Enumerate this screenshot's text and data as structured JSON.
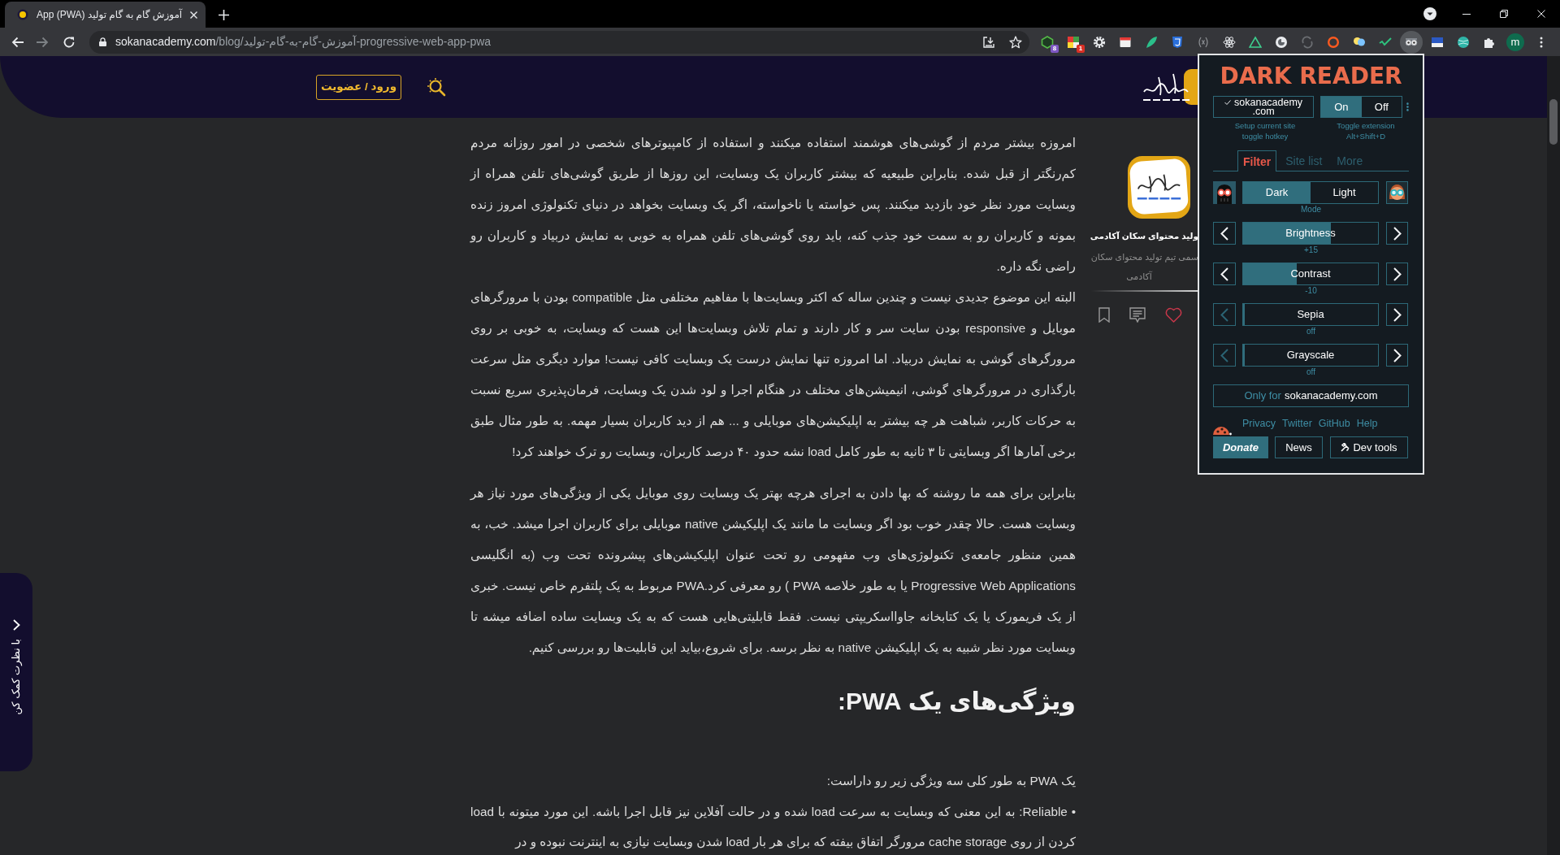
{
  "browser": {
    "tabs": [
      {
        "title": "آموزش گام به گام تولید App (PWA)",
        "selected": true
      }
    ],
    "address": {
      "host": "sokanacademy.com",
      "path": "/blog/آموزش-گام-به-گام-تولید-progressive-web-app-pwa"
    },
    "extensions": [
      {
        "kind": "puzzle",
        "active": false
      },
      {
        "kind": "globe",
        "active": false
      },
      {
        "kind": "banner",
        "active": false
      },
      {
        "kind": "goggles",
        "active": true
      },
      {
        "kind": "check",
        "active": false
      },
      {
        "kind": "bulb",
        "active": false
      },
      {
        "kind": "ring",
        "active": false
      },
      {
        "kind": "cycle",
        "active": false
      },
      {
        "kind": "disc",
        "active": false
      },
      {
        "kind": "triangle",
        "active": false
      },
      {
        "kind": "atom",
        "active": false
      },
      {
        "kind": "brackets",
        "active": false
      },
      {
        "kind": "shield",
        "active": false
      },
      {
        "kind": "leaf",
        "active": false
      },
      {
        "kind": "window",
        "active": false
      },
      {
        "kind": "gear",
        "active": false
      },
      {
        "kind": "grid",
        "active": false,
        "badge": {
          "text": "1",
          "color": "#d93025"
        }
      },
      {
        "kind": "hexagon",
        "active": false,
        "badge": {
          "text": "8",
          "color": "#7e57c2"
        }
      }
    ],
    "profile": {
      "initial": "m"
    }
  },
  "site_header": {
    "login_button": "ورود / عضویت"
  },
  "article": {
    "paragraphs": [
      "امروزه بیشتر مردم از گوشی‌های هوشمند استفاده میکنند و استفاده از کامپیوترهای شخصی در امور روزانه مردم کم‌رنگتر از قبل شده. بنابراین طبیعیه که بیشتر کاربران یک وبسایت، این روزها از طریق گوشی‌های تلفن همراه از وبسایت مورد نظر خود بازدید میکنند. پس خواسته یا ناخواسته، اگر یک وبسایت بخواهد در دنیای تکنولوژی امروز زنده بمونه و کاربران رو به سمت خود جذب کنه، باید روی گوشی‌های تلفن همراه به خوبی به نمایش دربیاد و کاربران رو راضی نگه داره.",
      "البته این موضوع جدیدی نیست و چندین ساله که اکثر وبسایت‌ها با مفاهیم مختلفی مثل compatible بودن با مرورگرهای موبایل و responsive بودن سایت سر و کار دارند و تمام تلاش وبسایت‌ها این هست که وبسایت، به خوبی بر روی مرورگرهای گوشی به نمایش دربیاد. اما امروزه تنها نمایش درست یک وبسایت کافی نیست! موارد دیگری مثل سرعت بارگذاری در مرورگرهای گوشی، انیمیشن‌های مختلف در هنگام اجرا و لود شدن یک وبسایت، فرمان‌پذیری سریع نسبت به حرکات کاربر، شباهت هر چه بیشتر به اپلیکیشن‌های موبایلی و ... هم از دید کاربران بسیار مهمه. به طور مثال طبق برخی آمارها اگر وبسایتی تا ۳ ثانیه به طور کامل load نشه حدود ۴۰ درصد کاربران، وبسایت رو ترک خواهند کرد!",
      "بنابراین برای همه ما روشنه که بها دادن به اجرای هرچه بهتر یک وبسایت روی موبایل یکی از ویژگی‌های مورد نیاز هر وبسایت هست. حالا چقدر خوب بود اگر وبسایت ما مانند یک اپلیکیشن native موبایلی برای کاربران اجرا میشد. خب، به همین منظور جامعه‌ی تکنولوژی‌های وب مفهومی رو تحت عنوان اپلیکیشن‌های پیشرونده تحت وب (به انگلیسی Progressive Web Applications یا به طور خلاصه PWA ) رو معرفی کرد.PWA مربوط به یک پلتفرم خاص نیست. خبری از یک فریمورک یا یک کتابخانه جاوااسکریپتی نیست. فقط قابلیتی‌هایی هست که به یک وبسایت ساده اضافه میشه تا وبسایت مورد نظر شبیه به یک اپلیکیشن native به نظر برسه. برای شروع،بیاید این قابلیت‌ها رو بررسی کنیم."
    ],
    "heading": "ویژگی‌های یک PWA:",
    "intro": "یک PWA به طور کلی سه ویژگی زیر رو داراست:",
    "bullets": [
      "• Reliable: به این معنی که وبسایت به سرعت load شده و در حالت آفلاین نیز قابل اجرا باشه. این مورد میتونه با load کردن از روی cache storage مرورگر اتفاق بیفته که برای هر بار load شدن وبسایت نیازی به اینترنت نبوده و در"
    ]
  },
  "author": {
    "name": "ولید محتوای سکان آکادمی",
    "bio": "سمی تیم تولید محتوای سکان آکادمی"
  },
  "feedback_tab": {
    "label": "با نظرت کمک کن"
  },
  "dark_reader": {
    "title": "DARK READER",
    "site_toggle": {
      "lines": [
        "sokanacademy",
        ".com"
      ],
      "checked": true
    },
    "power": [
      {
        "label": "Off",
        "selected": false
      },
      {
        "label": "On",
        "selected": true
      }
    ],
    "site_hint": [
      "Setup current site",
      "toggle hotkey"
    ],
    "power_hint": [
      "Toggle extension",
      "Alt+Shift+D"
    ],
    "tabs": [
      {
        "label": "More",
        "selected": false
      },
      {
        "label": "Site list",
        "selected": false
      },
      {
        "label": "Filter",
        "selected": true
      }
    ],
    "mode": {
      "options": [
        {
          "label": "Light",
          "selected": false
        },
        {
          "label": "Dark",
          "selected": true
        }
      ],
      "caption": "Mode"
    },
    "sliders": [
      {
        "label": "Brightness",
        "level": 0.65,
        "reading": "+15",
        "decrease_disabled": false
      },
      {
        "label": "Contrast",
        "level": 0.4,
        "reading": "-10",
        "decrease_disabled": false
      },
      {
        "label": "Sepia",
        "level": 0,
        "reading": "off",
        "decrease_disabled": true
      },
      {
        "label": "Grayscale",
        "level": 0,
        "reading": "off",
        "decrease_disabled": true
      }
    ],
    "site_only": {
      "prefix": "Only for",
      "site": "sokanacademy.com"
    },
    "links": [
      "Help",
      "GitHub",
      "Twitter",
      "Privacy"
    ],
    "buttons": [
      {
        "label": "Dev tools",
        "kind": "devtools"
      },
      {
        "label": "News",
        "kind": "plain"
      },
      {
        "label": "Donate",
        "kind": "donate"
      }
    ]
  }
}
